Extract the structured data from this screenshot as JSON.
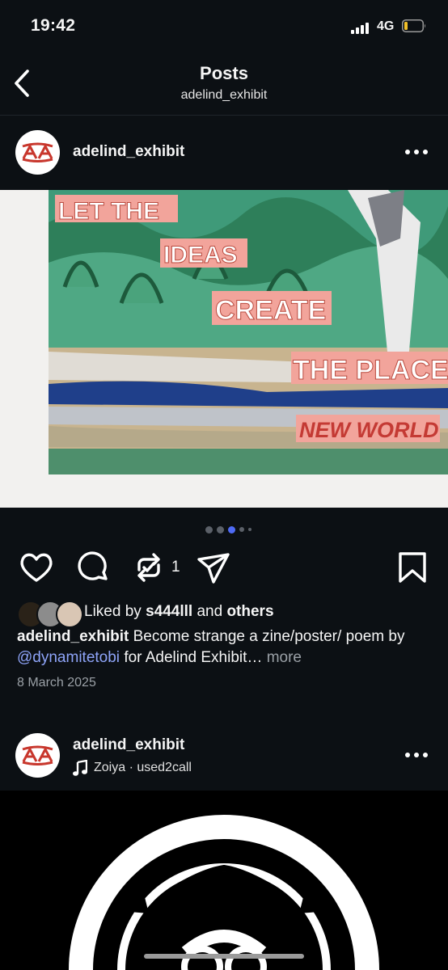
{
  "status": {
    "time": "19:42",
    "network": "4G"
  },
  "header": {
    "title": "Posts",
    "subtitle": "adelind_exhibit"
  },
  "post1": {
    "username": "adelind_exhibit",
    "image_text": [
      "LET THE",
      "IDEAS",
      "CREATE",
      "THE PLACE",
      "NEW WORLD"
    ],
    "carousel": {
      "count": 5,
      "active_index": 2
    },
    "repost_count": "1",
    "likes": {
      "prefix": "Liked by",
      "user": "s444lll",
      "joiner": "and",
      "others": "others"
    },
    "caption": {
      "username": "adelind_exhibit",
      "text_before": "Become strange a zine/poster/ poem by",
      "mention": "@dynamitetobi",
      "text_after": "for Adelind Exhibit…",
      "more": "more"
    },
    "date": "8 March 2025"
  },
  "post2": {
    "username": "adelind_exhibit",
    "audio": "Zoiya · used2call"
  },
  "colors": {
    "background": "#0c1014",
    "accent_mention": "#8ea4f8",
    "carousel_active": "#4f6bf5",
    "logo_red": "#c8372d"
  },
  "icons": [
    "signal-icon",
    "battery-icon",
    "back-chevron-icon",
    "more-dots-icon",
    "heart-icon",
    "comment-icon",
    "repost-icon",
    "share-icon",
    "bookmark-icon",
    "music-note-icon"
  ]
}
